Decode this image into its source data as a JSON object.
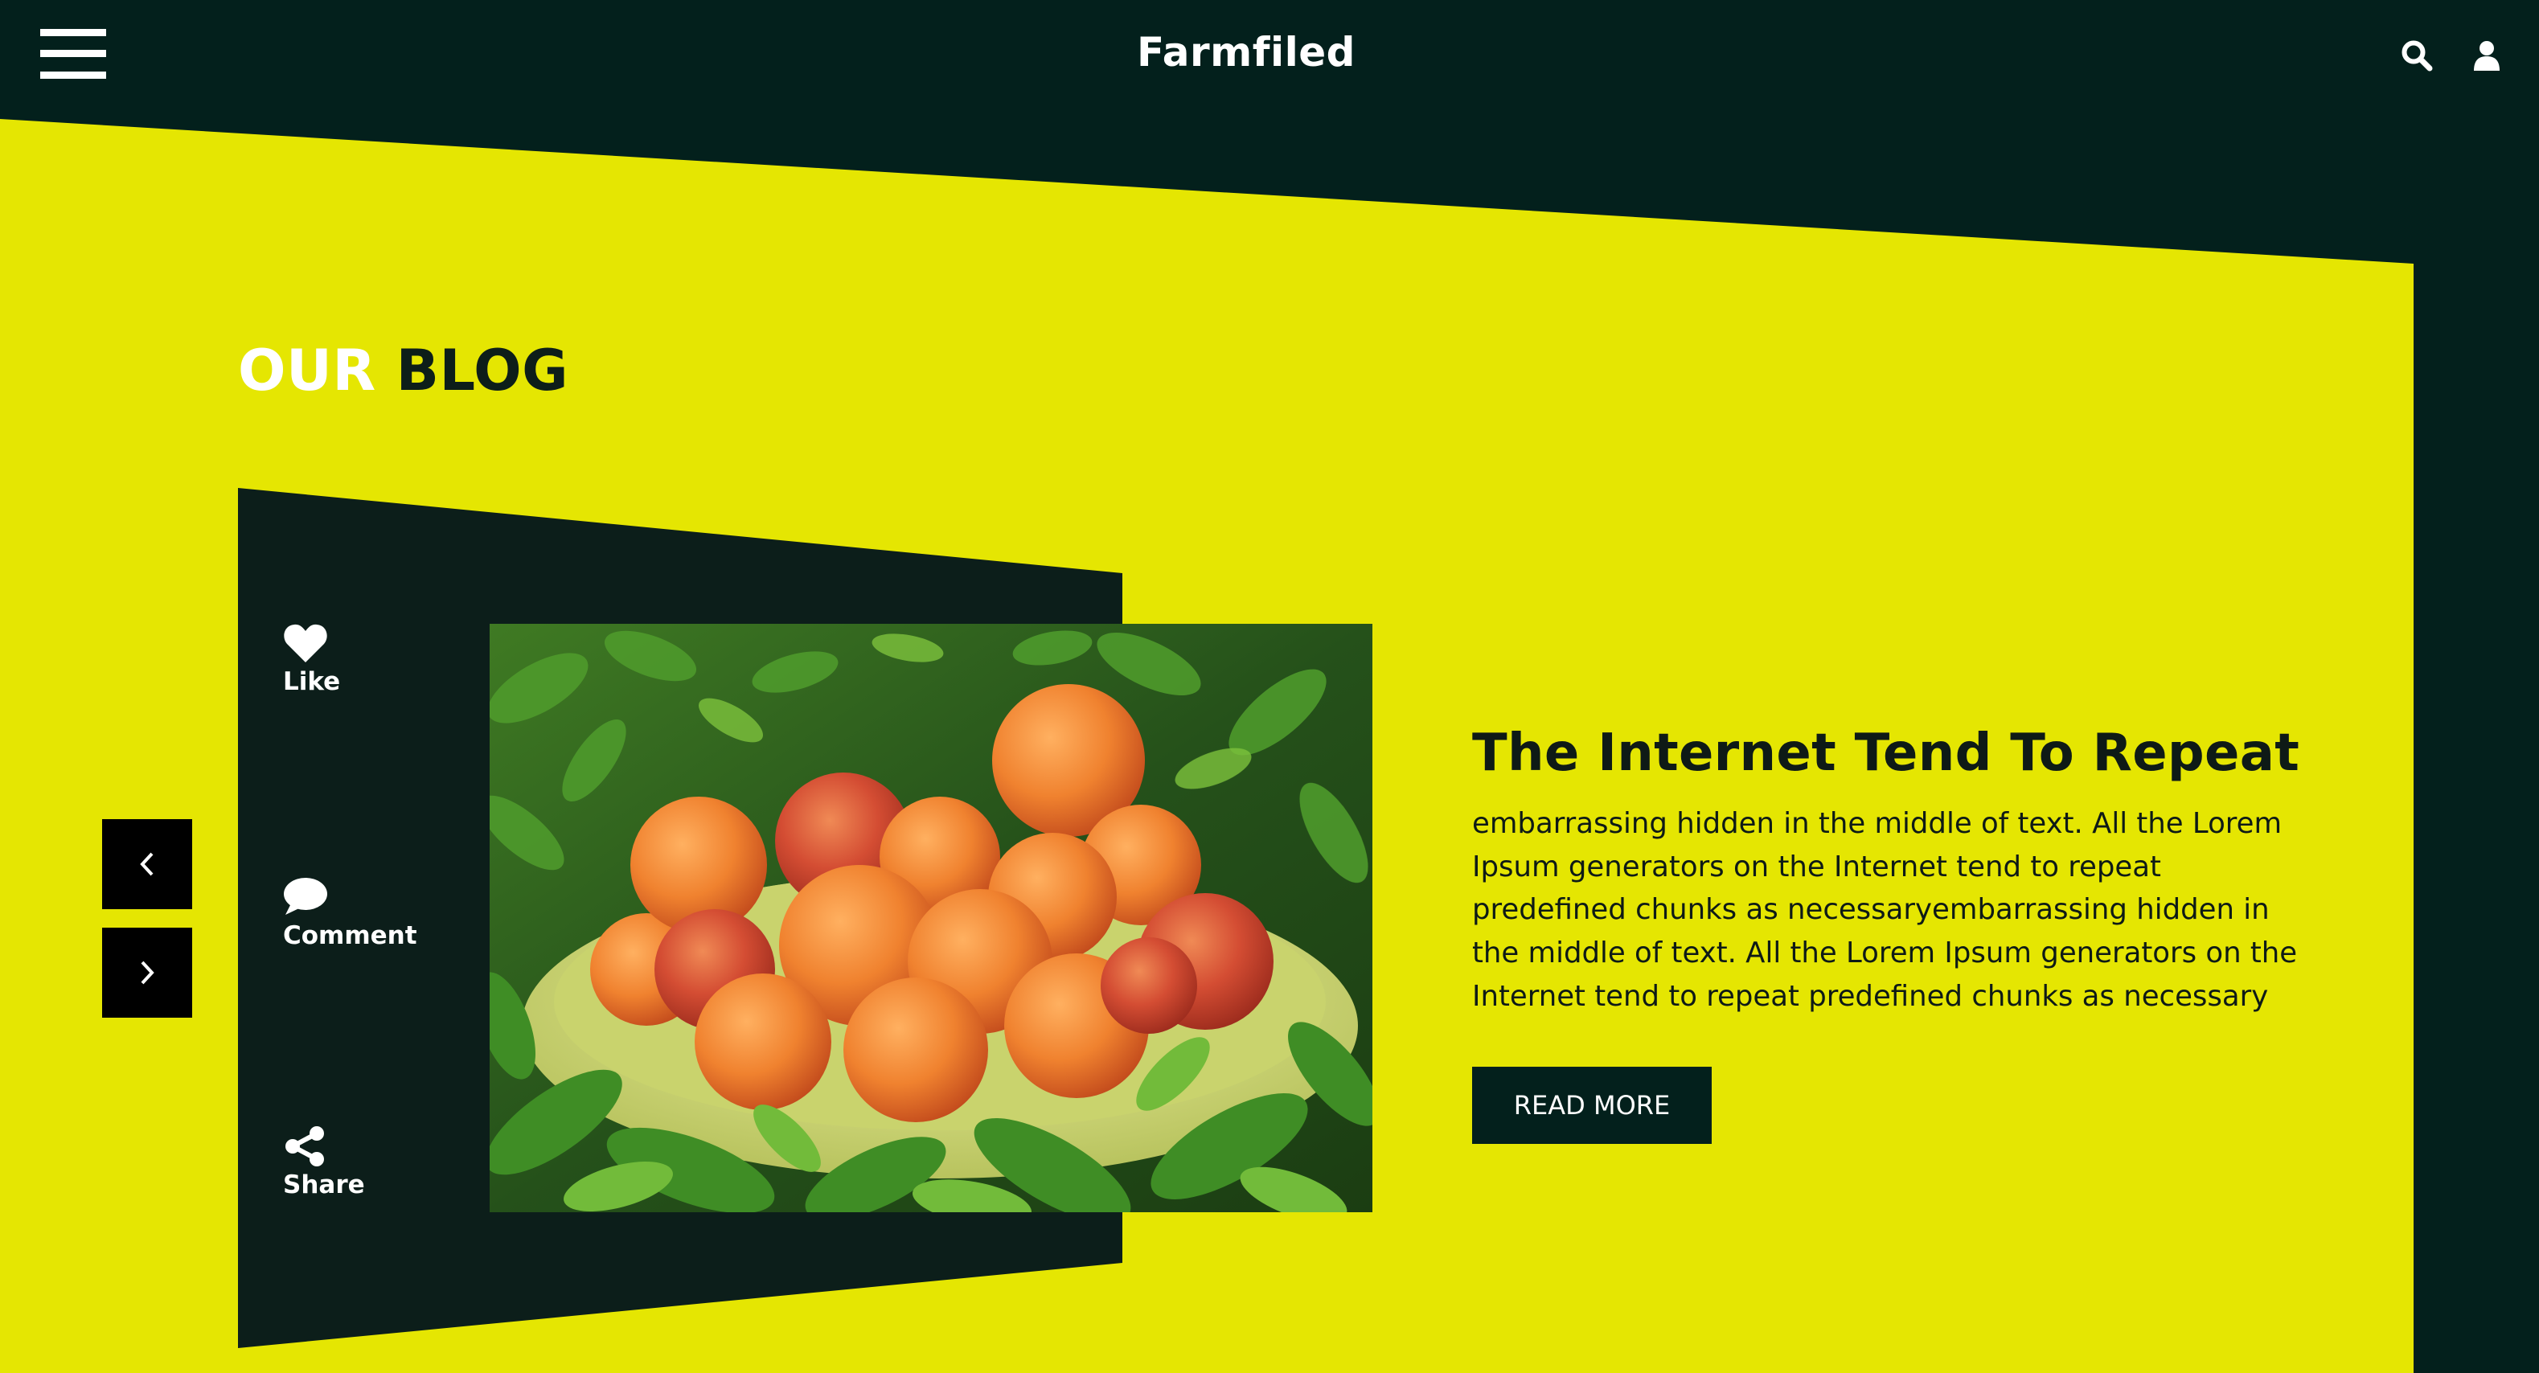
{
  "header": {
    "brand": "Farmfiled",
    "menu_icon": "hamburger-menu-icon",
    "search_icon": "search-icon",
    "user_icon": "user-icon"
  },
  "section": {
    "title_part1": "OUR",
    "title_part2": "BLOG"
  },
  "actions": [
    {
      "label": "Like",
      "icon": "heart-icon"
    },
    {
      "label": "Comment",
      "icon": "comment-icon"
    },
    {
      "label": "Share",
      "icon": "share-icon"
    }
  ],
  "slider": {
    "prev_icon": "chevron-left-icon",
    "next_icon": "chevron-right-icon"
  },
  "post": {
    "image": "apricots-in-bowl-photo",
    "title": "The Internet Tend To Repeat",
    "excerpt_lines": [
      "embarrassing hidden in the middle of text. All the Lorem",
      "Ipsum generators on the Internet tend to repeat",
      "predefined chunks as necessaryembarrassing hidden in",
      "the middle of text. All the Lorem Ipsum generators on the",
      "Internet tend to repeat predefined chunks as necessary"
    ],
    "read_more": "READ MORE"
  },
  "colors": {
    "dark": "#03201c",
    "card_dark": "#0c1e1a",
    "accent_yellow": "#e5e602",
    "white": "#ffffff"
  }
}
